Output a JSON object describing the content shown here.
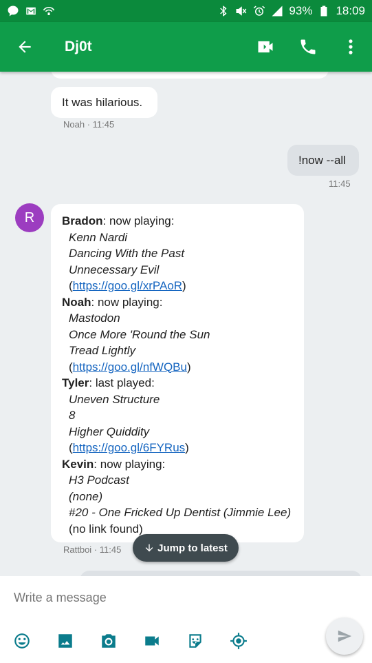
{
  "status_bar": {
    "battery": "93%",
    "time": "18:09"
  },
  "app_bar": {
    "title": "Dj0t"
  },
  "messages": [
    {
      "text": "It was hilarious.",
      "meta": "Noah · 11:45"
    },
    {
      "text": "!now --all",
      "meta": "11:45"
    }
  ],
  "bot_message": {
    "avatar_letter": "R",
    "meta": "Rattboi · 11:45",
    "entries": [
      {
        "name": "Bradon",
        "status": ": now playing:",
        "artist": "Kenn Nardi",
        "album": "Dancing With the Past",
        "track": "Unnecessary Evil",
        "link": "https://goo.gl/xrPAoR"
      },
      {
        "name": "Noah",
        "status": ": now playing:",
        "artist": "Mastodon",
        "album": "Once More 'Round the Sun",
        "track": "Tread Lightly",
        "link": "https://goo.gl/nfWQBu"
      },
      {
        "name": "Tyler",
        "status": ": last played:",
        "artist": "Uneven Structure",
        "album": "8",
        "track": "Higher Quiddity",
        "link": "https://goo.gl/6FYRus"
      },
      {
        "name": "Kevin",
        "status": ": now playing:",
        "artist": "H3 Podcast",
        "album": "(none)",
        "track": "#20 - One Fricked Up Dentist (Jimmie Lee)",
        "nolink": "(no link found)"
      }
    ]
  },
  "jump_button": {
    "label": "Jump to latest"
  },
  "compose": {
    "placeholder": "Write a message"
  },
  "colors": {
    "status_bar": "#0b8a3c",
    "app_bar": "#0f9d4a",
    "avatar": "#9c3dc0",
    "icons": "#0b7c8c"
  }
}
